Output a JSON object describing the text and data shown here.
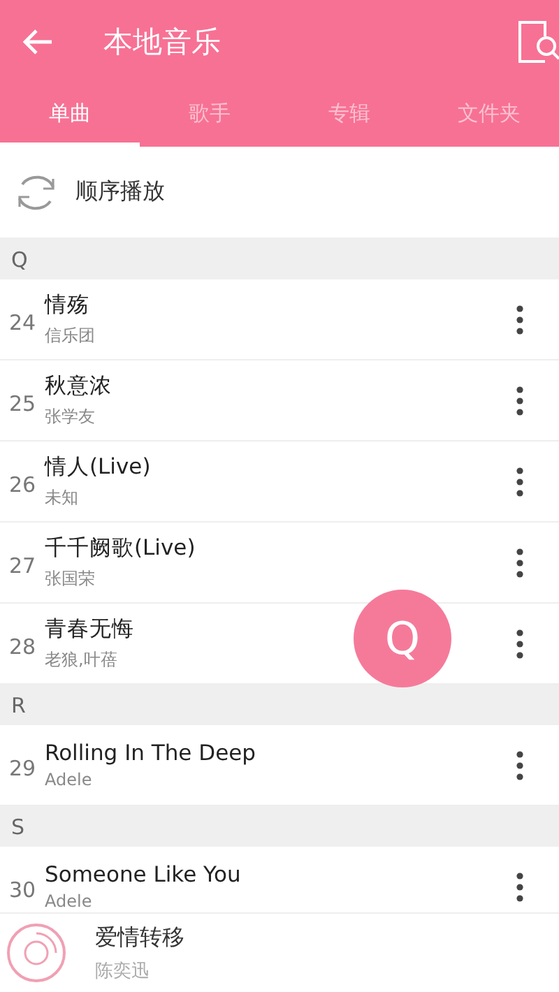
{
  "header": {
    "title": "本地音乐"
  },
  "tabs": [
    {
      "label": "单曲",
      "selected": true
    },
    {
      "label": "歌手",
      "selected": false
    },
    {
      "label": "专辑",
      "selected": false
    },
    {
      "label": "文件夹",
      "selected": false
    }
  ],
  "play_mode": {
    "label": "顺序播放"
  },
  "sections": [
    {
      "letter": "Q",
      "songs": [
        {
          "number": "24",
          "title": "情殇",
          "artist": "信乐团"
        },
        {
          "number": "25",
          "title": "秋意浓",
          "artist": "张学友"
        },
        {
          "number": "26",
          "title": "情人(Live)",
          "artist": "未知"
        },
        {
          "number": "27",
          "title": "千千阙歌(Live)",
          "artist": "张国荣"
        },
        {
          "number": "28",
          "title": "青春无悔",
          "artist": "老狼,叶蓓"
        }
      ]
    },
    {
      "letter": "R",
      "songs": [
        {
          "number": "29",
          "title": "Rolling In The Deep",
          "artist": "Adele"
        }
      ]
    },
    {
      "letter": "S",
      "songs": [
        {
          "number": "30",
          "title": "Someone Like You",
          "artist": "Adele"
        }
      ]
    }
  ],
  "index_bubble": {
    "letter": "Q"
  },
  "now_playing": {
    "title": "爱情转移",
    "artist": "陈奕迅"
  }
}
